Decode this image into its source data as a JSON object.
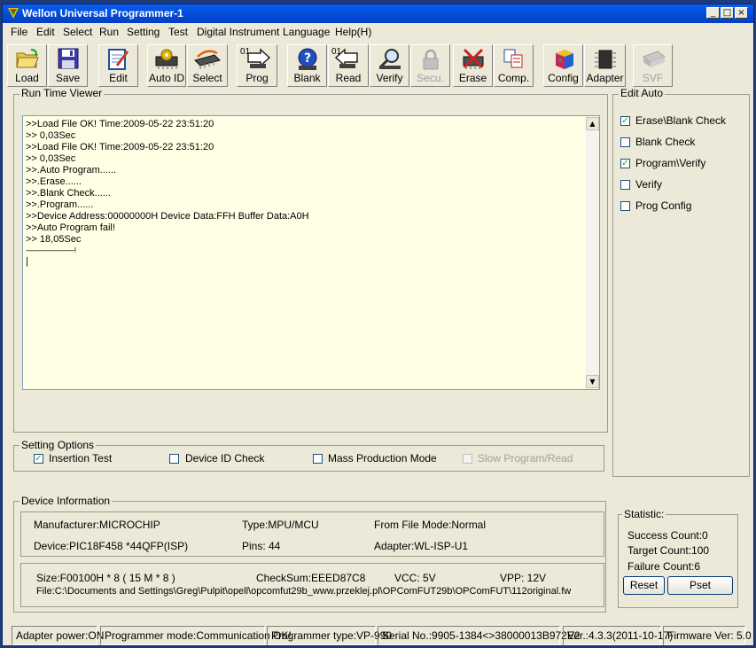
{
  "window": {
    "title": "Wellon Universal Programmer-1",
    "controls": [
      "_",
      "□",
      "×"
    ]
  },
  "menu": [
    "File",
    "Edit",
    "Select",
    "Run",
    "Setting",
    "Test",
    "Digital Instrument",
    "Language",
    "Help(H)"
  ],
  "toolbar": {
    "buttons": [
      {
        "label": "Load",
        "icon": "folder-open-icon"
      },
      {
        "label": "Save",
        "icon": "floppy-disk-icon"
      },
      {
        "label": "Edit",
        "icon": "notepad-edit-icon"
      },
      {
        "label": "Auto ID",
        "icon": "chip-gear-icon"
      },
      {
        "label": "Select",
        "icon": "chip-select-icon"
      },
      {
        "label": "Prog",
        "icon": "prog-arrow-icon",
        "prefix": "01"
      },
      {
        "label": "Blank",
        "icon": "help-circle-icon"
      },
      {
        "label": "Read",
        "icon": "read-arrow-icon",
        "prefix": "01"
      },
      {
        "label": "Verify",
        "icon": "magnifier-icon"
      },
      {
        "label": "Secu.",
        "icon": "lock-icon",
        "disabled": true
      },
      {
        "label": "Erase",
        "icon": "chip-erase-icon"
      },
      {
        "label": "Comp.",
        "icon": "compare-icon"
      },
      {
        "label": "Config",
        "icon": "cube-config-icon"
      },
      {
        "label": "Adapter",
        "icon": "adapter-chip-icon"
      },
      {
        "label": "SVF",
        "icon": "svf-chip-icon",
        "disabled": true
      }
    ]
  },
  "run_time_viewer": {
    "title": "Run Time Viewer",
    "lines": [
      ">>Load File OK! Time:2009-05-22 23:51:20",
      ">>  0,03Sec",
      ">>Load File OK! Time:2009-05-22 23:51:20",
      ">>  0,03Sec",
      ">>.Auto Program......",
      ">>.Erase......",
      ">>.Blank Check......",
      ">>.Program......",
      ">>Device Address:00000000H  Device Data:FFH  Buffer Data:A0H",
      ">>Auto Program fail!",
      ">> 18,05Sec",
      "---------------------------------!",
      "|"
    ]
  },
  "edit_auto": {
    "title": "Edit Auto",
    "items": [
      {
        "label": "Erase\\Blank Check",
        "checked": true
      },
      {
        "label": "Blank Check",
        "checked": false
      },
      {
        "label": "Program\\Verify",
        "checked": true
      },
      {
        "label": "Verify",
        "checked": false
      },
      {
        "label": "Prog Config",
        "checked": false
      }
    ]
  },
  "setting_options": {
    "title": "Setting Options",
    "items": [
      {
        "label": "Insertion Test",
        "checked": true,
        "disabled": false
      },
      {
        "label": "Device ID Check",
        "checked": false,
        "disabled": false
      },
      {
        "label": "Mass Production Mode",
        "checked": false,
        "disabled": false
      },
      {
        "label": "Slow Program/Read",
        "checked": false,
        "disabled": true
      }
    ]
  },
  "device_information": {
    "title": "Device Information",
    "manufacturer": "Manufacturer:MICROCHIP",
    "type": "Type:MPU/MCU",
    "from_file_mode": "From File Mode:Normal",
    "device": "Device:PIC18F458 *44QFP(ISP)",
    "pins": "Pins: 44",
    "adapter": "Adapter:WL-ISP-U1",
    "size": "Size:F00100H * 8 ( 15 M * 8 )",
    "checksum": "CheckSum:EEED87C8",
    "vcc": "VCC: 5V",
    "vpp": "VPP: 12V",
    "file": "File:C:\\Documents and Settings\\Greg\\Pulpit\\opell\\opcomfut29b_www.przeklej.pl\\OPComFUT29b\\OPComFUT\\112original.fw"
  },
  "statistic": {
    "title": "Statistic:",
    "success": "Success Count:0",
    "target": "Target Count:100",
    "failure": "Failure Count:6",
    "reset_label": "Reset",
    "pset_label": "Pset"
  },
  "status_bar": [
    "Adapter power:ON",
    "Programmer mode:Communication OK!",
    "Programmer type:VP-990",
    "Serial No.:9905-1384<>38000013B972E2",
    "Ver.:4.3.3(2011-10-17)",
    "Firmware Ver: 5.0"
  ],
  "colors": {
    "titlebar": "#0349d6",
    "window_bg": "#ece9d8",
    "log_bg": "#ffffe5",
    "check_mark": "#21a121"
  }
}
